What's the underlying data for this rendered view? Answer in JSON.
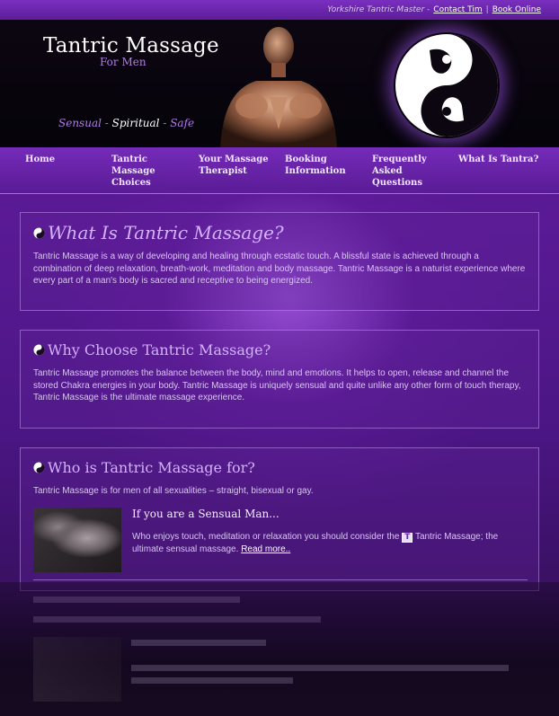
{
  "topbar": {
    "site_name": "Yorkshire Tantric Master -",
    "contact_link": "Contact Tim",
    "separator": "|",
    "book_link": "Book Online"
  },
  "header": {
    "title": "Tantric Massage",
    "subtitle": "For Men",
    "tagline_1": "Sensual -",
    "tagline_2": "Spiritual",
    "tagline_3": "- Safe"
  },
  "nav": {
    "items": [
      {
        "label": "Home"
      },
      {
        "label": "Tantric Massage Choices"
      },
      {
        "label": "Your Massage Therapist"
      },
      {
        "label": "Booking Information"
      },
      {
        "label": "Frequently Asked Questions"
      },
      {
        "label": "What Is Tantra?"
      }
    ]
  },
  "sections": {
    "what": {
      "heading": "What Is Tantric Massage?",
      "body": "Tantric Massage is a way of developing and healing through ecstatic touch. A blissful state is achieved through a combination of deep relaxation, breath-work, meditation and body massage. Tantric Massage is a naturist experience where every part of a man's body is sacred and receptive to being energized."
    },
    "why": {
      "heading": "Why Choose Tantric Massage?",
      "body": "Tantric Massage promotes the balance between the body, mind and emotions. It helps to open, release and channel the stored Chakra energies in your body. Tantric Massage is uniquely sensual and quite unlike any other form of touch therapy, Tantric Massage is the ultimate massage experience."
    },
    "who": {
      "heading": "Who is Tantric Massage for?",
      "intro": "Tantric Massage is for men of all sexualities – straight, bisexual or gay.",
      "sub_heading": "If you are a Sensual Man...",
      "sub_body_1": "Who enjoys touch, meditation or relaxation you should consider the",
      "badge": "T",
      "sub_body_2": "Tantric Massage; the ultimate sensual massage.",
      "read_more": "Read more.."
    }
  },
  "colors": {
    "accent_purple": "#7a2fbf",
    "heading_lilac": "#d4b2ff",
    "header_black": "#05030a"
  }
}
